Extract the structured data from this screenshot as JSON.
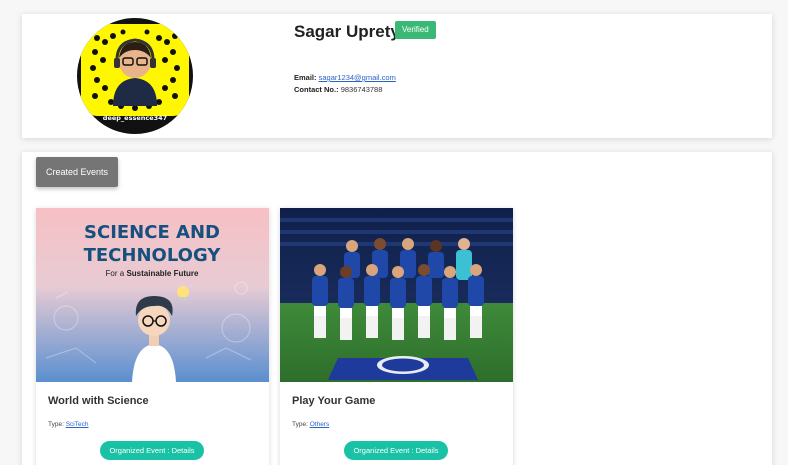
{
  "profile": {
    "name": "Sagar Uprety",
    "badge": "Verified",
    "avatar_caption": "deep_essence347",
    "email_label": "Email:",
    "email": "sagar1234@gmail.com",
    "phone_label": "Contact No.:",
    "phone": "9836743788"
  },
  "events_tab_label": "Created Events",
  "events": [
    {
      "title": "World with Science",
      "type_label": "Type:",
      "type": "SciTech",
      "button_label": "Organized Event : Details",
      "image_heading_1": "SCIENCE AND",
      "image_heading_2": "TECHNOLOGY",
      "image_subheading_prefix": "For a ",
      "image_subheading_bold": "Sustainable Future"
    },
    {
      "title": "Play Your Game",
      "type_label": "Type:",
      "type": "Others",
      "button_label": "Organized Event : Details"
    }
  ],
  "colors": {
    "badge": "#39b876",
    "button": "#19c2a5",
    "link": "#2a63c8",
    "tab": "#757575"
  }
}
